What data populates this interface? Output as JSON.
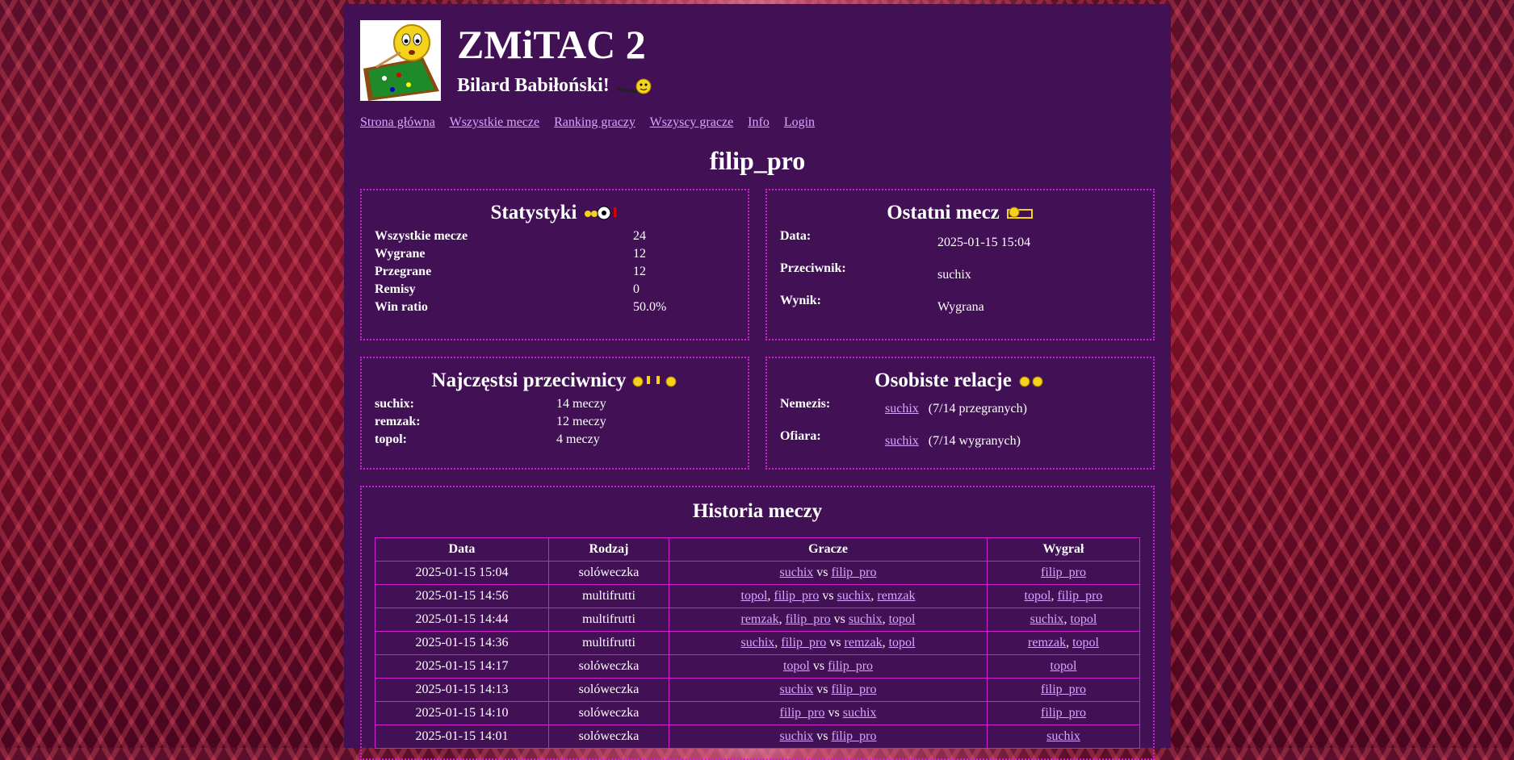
{
  "site": {
    "title": "ZMiTAC 2",
    "subtitle": "Bilard Babiłoński!"
  },
  "nav": [
    {
      "label": "Strona główna"
    },
    {
      "label": "Wszystkie mecze"
    },
    {
      "label": "Ranking graczy"
    },
    {
      "label": "Wszyscy gracze"
    },
    {
      "label": "Info"
    },
    {
      "label": "Login"
    }
  ],
  "player": "filip_pro",
  "stats": {
    "title": "Statystyki",
    "rows": [
      {
        "label": "Wszystkie mecze",
        "value": "24"
      },
      {
        "label": "Wygrane",
        "value": "12"
      },
      {
        "label": "Przegrane",
        "value": "12"
      },
      {
        "label": "Remisy",
        "value": "0"
      },
      {
        "label": "Win ratio",
        "value": "50.0%"
      }
    ]
  },
  "last_match": {
    "title": "Ostatni mecz",
    "rows": [
      {
        "label": "Data:",
        "value": "2025-01-15 15:04"
      },
      {
        "label": "Przeciwnik:",
        "value": "suchix"
      },
      {
        "label": "Wynik:",
        "value": "Wygrana"
      }
    ]
  },
  "opponents": {
    "title": "Najczęstsi przeciwnicy",
    "rows": [
      {
        "label": "suchix:",
        "value": "14 meczy"
      },
      {
        "label": "remzak:",
        "value": "12 meczy"
      },
      {
        "label": "topol:",
        "value": "4 meczy"
      }
    ]
  },
  "relations": {
    "title": "Osobiste relacje",
    "rows": [
      {
        "label": "Nemezis:",
        "link": "suchix",
        "note": "(7/14 przegranych)"
      },
      {
        "label": "Ofiara:",
        "link": "suchix",
        "note": "(7/14 wygranych)"
      }
    ]
  },
  "history": {
    "title": "Historia meczy",
    "headers": [
      "Data",
      "Rodzaj",
      "Gracze",
      "Wygrał"
    ],
    "rows": [
      {
        "date": "2025-01-15 15:04",
        "type": "solóweczka",
        "teamA": [
          "suchix"
        ],
        "teamB": [
          "filip_pro"
        ],
        "winner": [
          "filip_pro"
        ]
      },
      {
        "date": "2025-01-15 14:56",
        "type": "multifrutti",
        "teamA": [
          "topol",
          "filip_pro"
        ],
        "teamB": [
          "suchix",
          "remzak"
        ],
        "winner": [
          "topol",
          "filip_pro"
        ]
      },
      {
        "date": "2025-01-15 14:44",
        "type": "multifrutti",
        "teamA": [
          "remzak",
          "filip_pro"
        ],
        "teamB": [
          "suchix",
          "topol"
        ],
        "winner": [
          "suchix",
          "topol"
        ]
      },
      {
        "date": "2025-01-15 14:36",
        "type": "multifrutti",
        "teamA": [
          "suchix",
          "filip_pro"
        ],
        "teamB": [
          "remzak",
          "topol"
        ],
        "winner": [
          "remzak",
          "topol"
        ]
      },
      {
        "date": "2025-01-15 14:17",
        "type": "solóweczka",
        "teamA": [
          "topol"
        ],
        "teamB": [
          "filip_pro"
        ],
        "winner": [
          "topol"
        ]
      },
      {
        "date": "2025-01-15 14:13",
        "type": "solóweczka",
        "teamA": [
          "suchix"
        ],
        "teamB": [
          "filip_pro"
        ],
        "winner": [
          "filip_pro"
        ]
      },
      {
        "date": "2025-01-15 14:10",
        "type": "solóweczka",
        "teamA": [
          "filip_pro"
        ],
        "teamB": [
          "suchix"
        ],
        "winner": [
          "filip_pro"
        ]
      },
      {
        "date": "2025-01-15 14:01",
        "type": "solóweczka",
        "teamA": [
          "suchix"
        ],
        "teamB": [
          "filip_pro"
        ],
        "winner": [
          "suchix"
        ]
      }
    ],
    "vs": "vs"
  }
}
